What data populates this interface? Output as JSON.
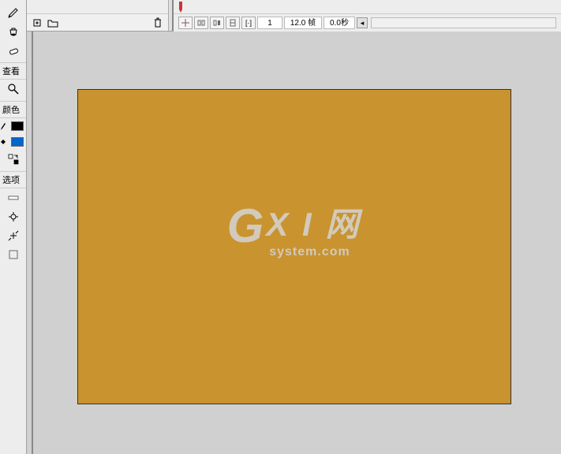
{
  "toolbar": {
    "icons": [
      "pencil-icon",
      "brush-icon",
      "ink-bottle-icon",
      "eraser-icon"
    ],
    "view_label": "查看",
    "color_label": "颜色",
    "options_label": "选项",
    "stroke_color": "#000000",
    "fill_color": "#0066cc"
  },
  "layer": {
    "add_layer_icon": "⊞",
    "add_folder_icon": "⊞",
    "trash_icon": "🗑"
  },
  "timeline": {
    "current_frame": "1",
    "fps": "12.0 帧",
    "elapsed": "0.0秒",
    "scroll_left": "◂"
  },
  "watermark": {
    "line1_g": "G",
    "line1_rest": "X I 网",
    "line2": "system.com"
  },
  "stage": {
    "bg_color": "#c9932f"
  }
}
